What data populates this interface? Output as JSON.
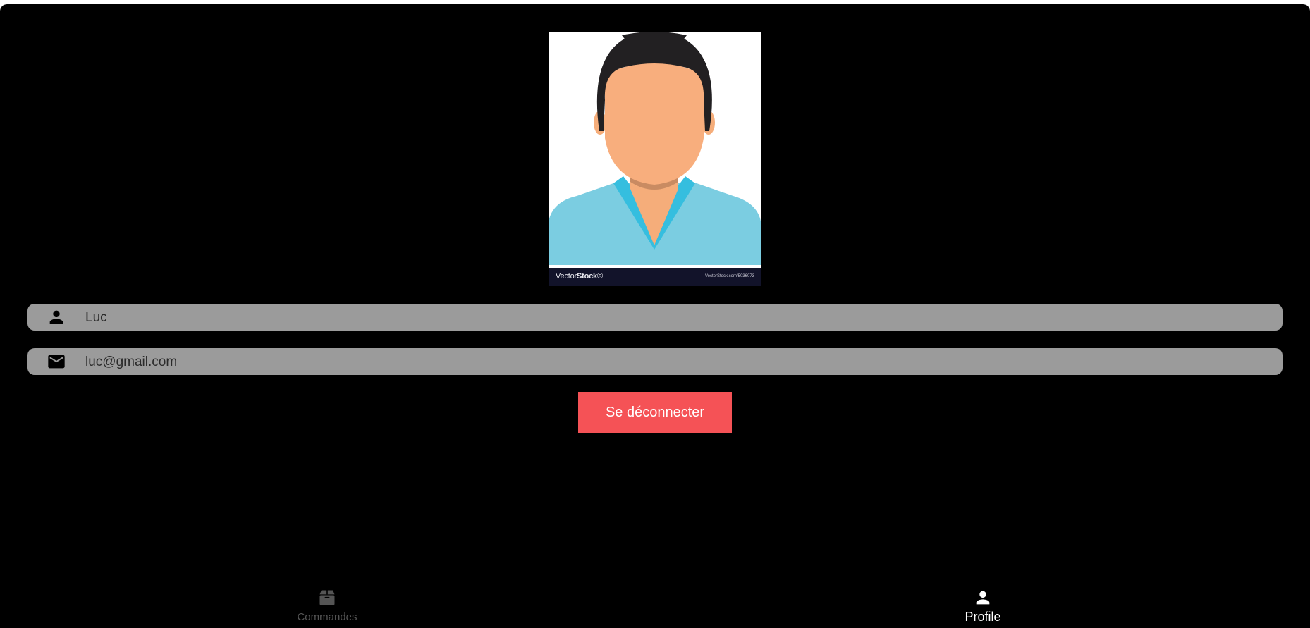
{
  "profile": {
    "avatar": {
      "icon": "user-avatar-illustration",
      "watermark_brand_prefix": "Vector",
      "watermark_brand_suffix": "Stock",
      "watermark_url": "VectorStock.com/5036073"
    },
    "fields": {
      "name": {
        "icon": "person-icon",
        "value": "Luc"
      },
      "email": {
        "icon": "mail-icon",
        "value": "luc@gmail.com"
      }
    },
    "logout_label": "Se déconnecter"
  },
  "bottom_nav": {
    "items": [
      {
        "icon": "package-icon",
        "label": "Commandes",
        "active": false
      },
      {
        "icon": "person-icon",
        "label": "Profile",
        "active": true
      }
    ]
  },
  "colors": {
    "background": "#000000",
    "field_background": "#9b9b9b",
    "logout_button": "#f55256",
    "nav_active": "#ffffff",
    "nav_inactive": "#555555"
  }
}
